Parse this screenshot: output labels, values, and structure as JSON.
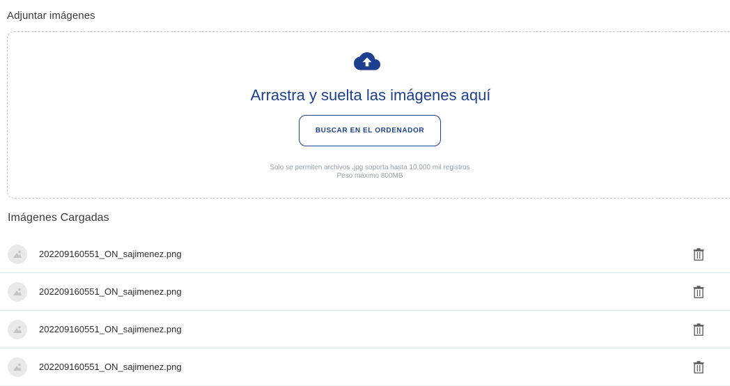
{
  "attach": {
    "title": "Adjuntar imágenes",
    "drop_text": "Arrastra y suelta las imágenes aquí",
    "browse_label": "BUSCAR EN EL ORDENADOR",
    "hint_line1": "Solo se permiten archivos .jpg soporta hasta 10,000 mil registros",
    "hint_line2": "Peso máximo 800MB",
    "upload_icon": "cloud-upload-icon"
  },
  "loaded": {
    "title": "Imágenes Cargadas",
    "files": [
      {
        "name": "202209160551_ON_sajimenez.png",
        "thumb_icon": "image-icon",
        "action_icon": "trash-icon"
      },
      {
        "name": "202209160551_ON_sajimenez.png",
        "thumb_icon": "image-icon",
        "action_icon": "trash-icon"
      },
      {
        "name": "202209160551_ON_sajimenez.png",
        "thumb_icon": "image-icon",
        "action_icon": "trash-icon"
      },
      {
        "name": "202209160551_ON_sajimenez.png",
        "thumb_icon": "image-icon",
        "action_icon": "trash-icon"
      }
    ]
  },
  "colors": {
    "accent": "#1c3f8f",
    "hint": "#9aa0a8",
    "divider": "#dbe8f0"
  }
}
